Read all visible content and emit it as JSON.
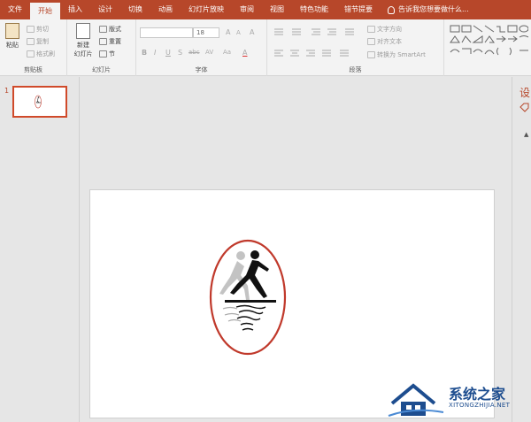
{
  "tabs": [
    {
      "label": "文件",
      "active": false
    },
    {
      "label": "开始",
      "active": true
    },
    {
      "label": "插入",
      "active": false
    },
    {
      "label": "设计",
      "active": false
    },
    {
      "label": "切换",
      "active": false
    },
    {
      "label": "动画",
      "active": false
    },
    {
      "label": "幻灯片放映",
      "active": false
    },
    {
      "label": "审阅",
      "active": false
    },
    {
      "label": "视图",
      "active": false
    },
    {
      "label": "特色功能",
      "active": false
    },
    {
      "label": "错节提要",
      "active": false
    }
  ],
  "tell_me": "告诉我您想要做什么...",
  "ribbon": {
    "clipboard": {
      "group_label": "剪贴板",
      "paste": "粘贴",
      "cut": "剪切",
      "copy": "复制",
      "format_painter": "格式刷"
    },
    "slides": {
      "group_label": "幻灯片",
      "new_slide_line1": "新建",
      "new_slide_line2": "幻灯片",
      "layout": "版式",
      "reset": "重置",
      "section": "节"
    },
    "font": {
      "group_label": "字体",
      "font_name": "",
      "font_size": "18",
      "bold": "B",
      "italic": "I",
      "underline": "U",
      "shadow": "S",
      "strike": "abc",
      "spacing": "AV",
      "change_case": "Aa",
      "font_color": "A",
      "grow": "A",
      "shrink": "A",
      "clear": "A"
    },
    "paragraph": {
      "group_label": "段落",
      "text_direction": "文字方向",
      "align_text": "对齐文本",
      "smartart": "转换为 SmartArt"
    }
  },
  "thumbnail": {
    "number": "1"
  },
  "side_panel_char": "设",
  "watermark": {
    "title": "系统之家",
    "url": "XITONGZHIJIA.NET"
  },
  "colors": {
    "accent": "#b7472a",
    "oval": "#c0392b",
    "watermark": "#1d4d8f"
  }
}
